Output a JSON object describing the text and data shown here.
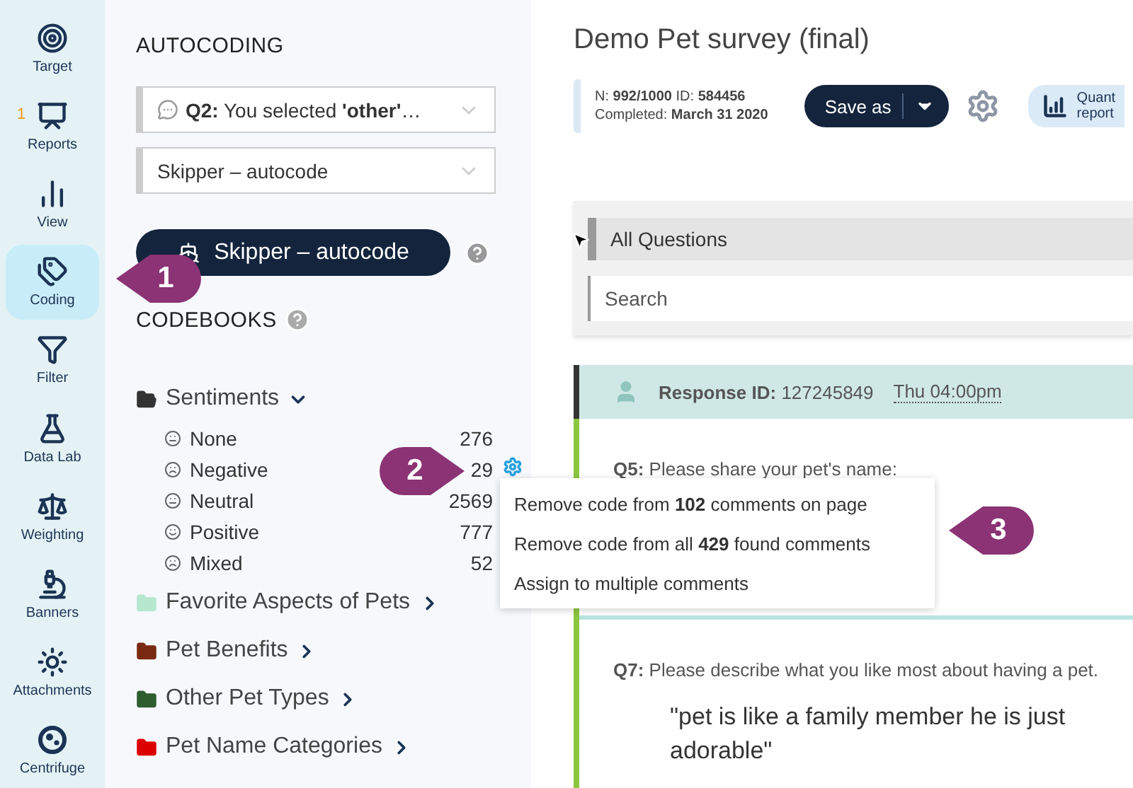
{
  "nav": [
    {
      "label": "Target",
      "selected": false
    },
    {
      "label": "Reports",
      "selected": false,
      "badge": "1"
    },
    {
      "label": "View",
      "selected": false
    },
    {
      "label": "Coding",
      "selected": true
    },
    {
      "label": "Filter",
      "selected": false
    },
    {
      "label": "Data Lab",
      "selected": false
    },
    {
      "label": "Weighting",
      "selected": false
    },
    {
      "label": "Banners",
      "selected": false
    },
    {
      "label": "Attachments",
      "selected": false
    },
    {
      "label": "Centrifuge",
      "selected": false
    }
  ],
  "autocoding": {
    "heading": "AUTOCODING",
    "question_select": "**Q2:** You selected **'other'**…",
    "model_select": "Skipper – autocode",
    "run_button": "Skipper – autocode"
  },
  "codebooks": {
    "heading": "CODEBOOKS",
    "folders": [
      {
        "name": "Sentiments",
        "color": "#333333",
        "expanded": true,
        "children": [
          {
            "name": "None",
            "count": "276"
          },
          {
            "name": "Negative",
            "count": "29",
            "menu": true
          },
          {
            "name": "Neutral",
            "count": "2569"
          },
          {
            "name": "Positive",
            "count": "777"
          },
          {
            "name": "Mixed",
            "count": "52"
          }
        ]
      },
      {
        "name": "Favorite Aspects of Pets",
        "color": "#b5e8cf",
        "expanded": false
      },
      {
        "name": "Pet Benefits",
        "color": "#7a2a10",
        "expanded": false
      },
      {
        "name": "Other Pet Types",
        "color": "#2e5e2e",
        "expanded": false
      },
      {
        "name": "Pet Name Categories",
        "color": "#dd0000",
        "expanded": false
      }
    ]
  },
  "context_menu": [
    "Remove code from **102** comments on page",
    "Remove code from all **429** found comments",
    "Assign to multiple comments"
  ],
  "callouts": [
    "1",
    "2",
    "3"
  ],
  "survey": {
    "title": "Demo Pet survey (final)",
    "info": [
      "N: **992/1000** ID: **584456**",
      "Completed: **March 31 2020**"
    ],
    "save_button": "Save as",
    "report_button": "Quant report"
  },
  "filter": {
    "select": "All Questions",
    "search_placeholder": "Search"
  },
  "response": {
    "label": "**Response ID:** 127245849",
    "time": "Thu 04:00pm",
    "answers": [
      {
        "question": "**Q5:** Please share your pet's name:"
      },
      {
        "question": "**Q7:** Please describe what you like most about having a pet.",
        "answer": "\"pet is like a family member he is just adorable\""
      }
    ]
  }
}
